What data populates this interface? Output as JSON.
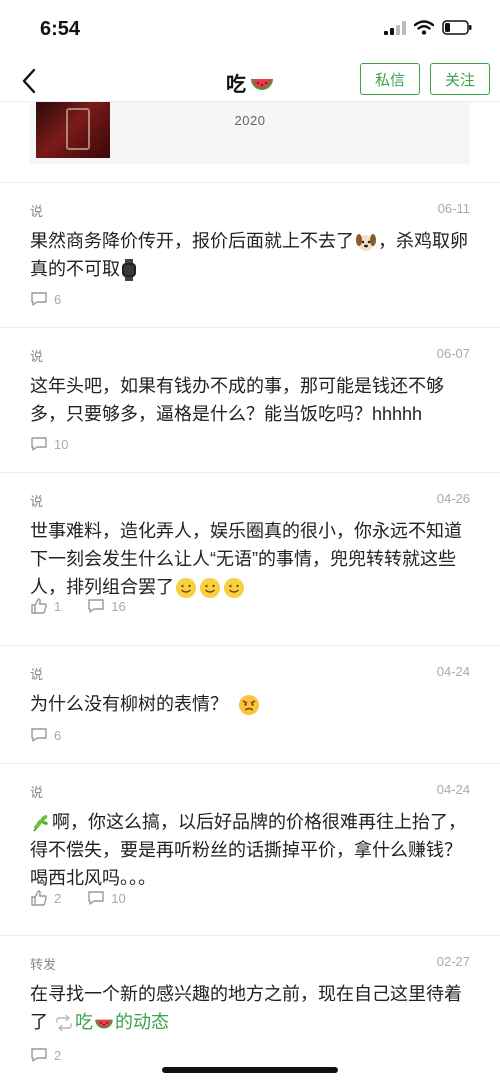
{
  "status_bar": {
    "time": "6:54"
  },
  "nav": {
    "title": "吃",
    "message_button": "私信",
    "follow_button": "关注"
  },
  "year_marker": "2020",
  "colors": {
    "accent_green": "#3aa34a",
    "text": "#222222",
    "meta_grey": "#aaaaaa"
  },
  "posts": [
    {
      "type": "说",
      "date": "06-11",
      "text_parts": [
        "果然商务降价传开，报价后面就上不去了",
        "，杀鸡取卵真的不可取"
      ],
      "likes": "",
      "comments": "6"
    },
    {
      "type": "说",
      "date": "06-07",
      "text": "这年头吧，如果有钱办不成的事，那可能是钱还不够多，只要够多，逼格是什么？能当饭吃吗？hhhhh",
      "likes": "",
      "comments": "10"
    },
    {
      "type": "说",
      "date": "04-26",
      "text": "世事难料，造化弄人，娱乐圈真的很小，你永远不知道下一刻会发生什么让人“无语”的事情，兜兜转转就这些人，排列组合罢了",
      "likes": "1",
      "comments": "16"
    },
    {
      "type": "说",
      "date": "04-24",
      "text": "为什么没有柳树的表情？",
      "likes": "",
      "comments": "6"
    },
    {
      "type": "说",
      "date": "04-24",
      "text": "啊，你这么搞，以后好品牌的价格很难再往上抬了，得不偿失，要是再听粉丝的话撕掉平价，拿什么赚钱？喝西北风吗。。。",
      "likes": "2",
      "comments": "10"
    },
    {
      "type": "转发",
      "date": "02-27",
      "text": "在寻找一个新的感兴趣的地方之前，现在自己这里待着了",
      "repost_name": "吃",
      "repost_suffix": "的动态",
      "likes": "",
      "comments": "2"
    }
  ],
  "icons": [
    "back-arrow-icon",
    "watermelon-icon",
    "comment-icon",
    "like-icon",
    "repost-icon",
    "puppy-emoji-icon",
    "watch-emoji-icon",
    "smile-emoji-icon",
    "angry-emoji-icon",
    "herb-emoji-icon",
    "signal-icon",
    "wifi-icon",
    "battery-icon"
  ]
}
